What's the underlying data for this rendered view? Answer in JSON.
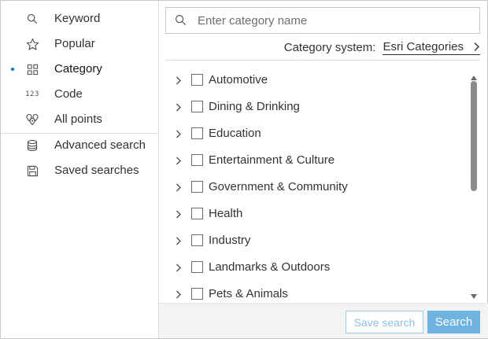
{
  "sidebar": {
    "items": [
      {
        "label": "Keyword",
        "icon": "search-icon",
        "active": false
      },
      {
        "label": "Popular",
        "icon": "star-icon",
        "active": false
      },
      {
        "label": "Category",
        "icon": "grid-icon",
        "active": true
      },
      {
        "label": "Code",
        "icon": "numbers-icon",
        "icon_text": "123",
        "active": false
      },
      {
        "label": "All points",
        "icon": "map-pins-icon",
        "active": false
      },
      {
        "label": "Advanced search",
        "icon": "database-icon",
        "active": false
      },
      {
        "label": "Saved searches",
        "icon": "save-icon",
        "active": false
      }
    ]
  },
  "search": {
    "placeholder": "Enter category name",
    "value": ""
  },
  "category_system": {
    "label": "Category system:",
    "value": "Esri Categories"
  },
  "categories": [
    {
      "name": "Automotive",
      "checked": false
    },
    {
      "name": "Dining & Drinking",
      "checked": false
    },
    {
      "name": "Education",
      "checked": false
    },
    {
      "name": "Entertainment & Culture",
      "checked": false
    },
    {
      "name": "Government & Community",
      "checked": false
    },
    {
      "name": "Health",
      "checked": false
    },
    {
      "name": "Industry",
      "checked": false
    },
    {
      "name": "Landmarks & Outdoors",
      "checked": false
    },
    {
      "name": "Pets & Animals",
      "checked": false
    }
  ],
  "footer": {
    "save_label": "Save search",
    "search_label": "Search"
  },
  "colors": {
    "accent": "#007ac2",
    "primary_button": "#6fb3e0",
    "text": "#323232"
  }
}
